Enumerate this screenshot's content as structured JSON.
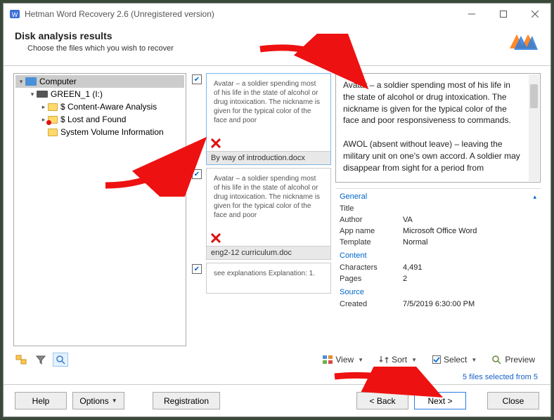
{
  "window": {
    "title": "Hetman Word Recovery 2.6 (Unregistered version)"
  },
  "header": {
    "title": "Disk analysis results",
    "subtitle": "Choose the files which you wish to recover"
  },
  "tree": {
    "root": "Computer",
    "drive": "GREEN_1 (I:)",
    "items": [
      {
        "label": "$ Content-Aware Analysis",
        "flag": false
      },
      {
        "label": "$ Lost and Found",
        "flag": true
      },
      {
        "label": "System Volume Information",
        "flag": false
      }
    ]
  },
  "files": [
    {
      "checked": true,
      "selected": true,
      "snippet": "Avatar – a soldier spending most of his life in the state of alcohol or drug intoxication. The nickname is given for the typical color of the face and poor",
      "name": "By way of introduction.docx"
    },
    {
      "checked": true,
      "selected": false,
      "snippet": "Avatar – a soldier spending most of his life in the state of alcohol or drug intoxication. The nickname is given for the typical color of the face and poor",
      "name": "eng2-12 curriculum.doc"
    },
    {
      "checked": true,
      "selected": false,
      "snippet": "see explanations Explanation: 1.",
      "name": ""
    }
  ],
  "preview": {
    "text": "Avatar – a soldier spending most of his life in the state of alcohol or drug intoxication. The nickname is given for the typical color of the face and poor responsiveness to commands.\n\nAWOL (absent without leave) – leaving the military unit on one's own accord. A soldier may disappear from sight for a period from"
  },
  "meta": {
    "sections": {
      "general": {
        "title": "General",
        "rows": [
          {
            "k": "Title",
            "v": ""
          },
          {
            "k": "Author",
            "v": "VA"
          },
          {
            "k": "App name",
            "v": "Microsoft Office Word"
          },
          {
            "k": "Template",
            "v": "Normal"
          }
        ]
      },
      "content": {
        "title": "Content",
        "rows": [
          {
            "k": "Characters",
            "v": "4,491"
          },
          {
            "k": "Pages",
            "v": "2"
          }
        ]
      },
      "source": {
        "title": "Source",
        "rows": [
          {
            "k": "Created",
            "v": "7/5/2019 6:30:00 PM"
          }
        ]
      }
    }
  },
  "toolbar": {
    "view": "View",
    "sort": "Sort",
    "select": "Select",
    "preview": "Preview"
  },
  "selection": {
    "text": "5 files selected from 5"
  },
  "footer": {
    "help": "Help",
    "options": "Options",
    "registration": "Registration",
    "back": "< Back",
    "next": "Next >",
    "close": "Close"
  }
}
